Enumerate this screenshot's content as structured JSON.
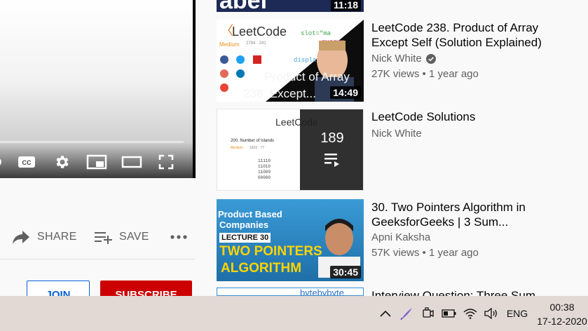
{
  "player": {
    "controls": [
      "miniplayer-toggle-icon",
      "subtitles-icon",
      "settings-icon",
      "miniplayer-icon",
      "theater-mode-icon",
      "fullscreen-icon"
    ]
  },
  "actions": {
    "share_label": "SHARE",
    "save_label": "SAVE"
  },
  "buttons": {
    "join_label": "JOIN",
    "subscribe_label": "SUBSCRIBE"
  },
  "recommendations": [
    {
      "duration": "11:18",
      "thumb_text": "abel"
    },
    {
      "title": "LeetCode 238. Product of Array Except Self (Solution Explained)",
      "channel": "Nick White",
      "verified": true,
      "views": "27K views",
      "age": "1 year ago",
      "duration": "14:49",
      "thumb_brand": "LeetCode",
      "thumb_level": "Medium",
      "thumb_counts": "2784 · 241",
      "thumb_overlay_line1": "Product of Array",
      "thumb_overlay_line2": "238. Except..."
    },
    {
      "title": "LeetCode Solutions",
      "channel": "Nick White",
      "playlist_count": "189",
      "thumb_brand": "LeetCode",
      "thumb_problem": "200. Number of Islands",
      "thumb_level": "Medium",
      "thumb_counts": "1833 · 77",
      "thumb_grid": [
        "11110",
        "11010",
        "11000",
        "00000"
      ]
    },
    {
      "title": "30. Two Pointers Algorithm in GeeksforGeeks | 3 Sum...",
      "channel": "Apni Kaksha",
      "views": "57K views",
      "age": "1 year ago",
      "duration": "30:45",
      "thumb_banner_line1": "Product Based",
      "thumb_banner_line2": "Companies",
      "thumb_lecture": "LECTURE 30",
      "thumb_headline_line1": "TWO POINTERS",
      "thumb_headline_line2": "ALGORITHM"
    },
    {
      "title": "Interview Question: Three Sum",
      "thumb_brand": "bytebybyte"
    }
  ],
  "taskbar": {
    "language": "ENG",
    "time": "00:38",
    "date": "17-12-2020",
    "tray_icons": [
      "chevron-up-icon",
      "pen-icon",
      "meet-now-icon",
      "battery-icon",
      "wifi-icon",
      "volume-icon"
    ]
  },
  "colors": {
    "subscribe": "#cc0000",
    "join_border": "#065fd4",
    "taskbar": "#e2d9d5"
  }
}
